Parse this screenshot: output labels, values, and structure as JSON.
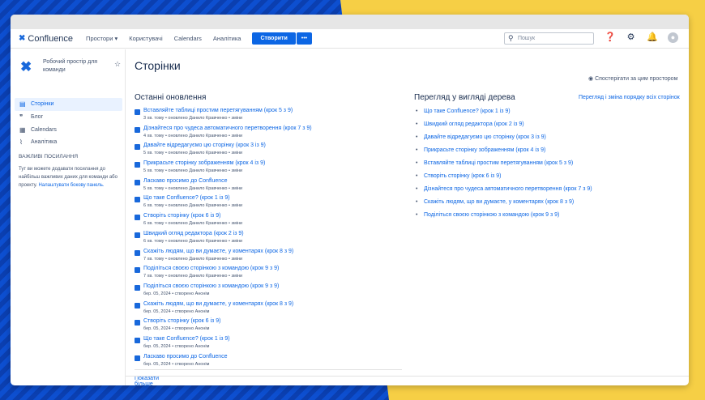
{
  "nav": {
    "brand": "Confluence",
    "items": [
      "Простори",
      "Користувачі",
      "Calendars",
      "Аналітика"
    ],
    "create": "Створити",
    "more": "•••",
    "search_placeholder": "Пошук"
  },
  "sidebar": {
    "space_name": "Робочий простір для команди",
    "items": [
      {
        "label": "Сторінки",
        "icon": "page-icon",
        "active": true
      },
      {
        "label": "Блог",
        "icon": "quote-icon"
      },
      {
        "label": "Calendars",
        "icon": "calendar-icon"
      },
      {
        "label": "Аналітика",
        "icon": "chart-icon"
      }
    ],
    "links_heading": "ВАЖЛИВІ ПОСИЛАННЯ",
    "links_text": "Тут ви можете додавати посилання до найбільш важливих даних для команди або проекту.",
    "links_link": "Налаштувати бокову панель."
  },
  "main": {
    "title": "Сторінки",
    "watch": "Спостерігати за цим простором",
    "recent_title": "Останні оновлення",
    "show_more": "Показати більше",
    "recent": [
      {
        "t": "Вставляйте таблиці простим перетягуванням (крок 5 з 9)",
        "m": "3 хв. тому • оновлено Данило Кравченко • зміни"
      },
      {
        "t": "Дізнайтеся про чудеса автоматичного перетворення (крок 7 з 9)",
        "m": "4 хв. тому • оновлено Данило Кравченко • зміни"
      },
      {
        "t": "Давайте відредагуємо цю сторінку (крок 3 із 9)",
        "m": "5 хв. тому • оновлено Данило Кравченко • зміни"
      },
      {
        "t": "Прикрасьте сторінку зображенням (крок 4 із 9)",
        "m": "5 хв. тому • оновлено Данило Кравченко • зміни"
      },
      {
        "t": "Ласкаво просимо до Confluence",
        "m": "5 хв. тому • оновлено Данило Кравченко • зміни"
      },
      {
        "t": "Що таке Confluence? (крок 1 із 9)",
        "m": "6 хв. тому • оновлено Данило Кравченко • зміни"
      },
      {
        "t": "Створіть сторінку (крок 6 із 9)",
        "m": "6 хв. тому • оновлено Данило Кравченко • зміни"
      },
      {
        "t": "Швидкий огляд редактора (крок 2 із 9)",
        "m": "6 хв. тому • оновлено Данило Кравченко • зміни"
      },
      {
        "t": "Скажіть людям, що ви думаєте, у коментарях (крок 8 з 9)",
        "m": "7 хв. тому • оновлено Данило Кравченко • зміни"
      },
      {
        "t": "Поділіться своєю сторінкою з командою (крок 9 з 9)",
        "m": "7 хв. тому • оновлено Данило Кравченко • зміни"
      },
      {
        "t": "Поділіться своєю сторінкою з командою (крок 9 з 9)",
        "m": "бер. 05, 2024 • створено Анонім"
      },
      {
        "t": "Скажіть людям, що ви думаєте, у коментарях (крок 8 з 9)",
        "m": "бер. 05, 2024 • створено Анонім"
      },
      {
        "t": "Створіть сторінку (крок 6 із 9)",
        "m": "бер. 05, 2024 • створено Анонім"
      },
      {
        "t": "Що таке Confluence? (крок 1 із 9)",
        "m": "бер. 05, 2024 • створено Анонім"
      },
      {
        "t": "Ласкаво просимо до Confluence",
        "m": "бер. 05, 2024 • створено Анонім"
      }
    ],
    "tree_title": "Перегляд у вигляді дерева",
    "reorder": "Перегляд і зміна порядку всіх сторінок",
    "tree": [
      "Що таке Confluence? (крок 1 із 9)",
      "Швидкий огляд редактора (крок 2 із 9)",
      "Давайте відредагуємо цю сторінку (крок 3 із 9)",
      "Прикрасьте сторінку зображенням (крок 4 із 9)",
      "Вставляйте таблиці простим перетягуванням (крок 5 з 9)",
      "Створіть сторінку (крок 6 із 9)",
      "Дізнайтеся про чудеса автоматичного перетворення (крок 7 з 9)",
      "Скажіть людям, що ви думаєте, у коментарях (крок 8 з 9)",
      "Поділіться своєю сторінкою з командою (крок 9 з 9)"
    ]
  }
}
